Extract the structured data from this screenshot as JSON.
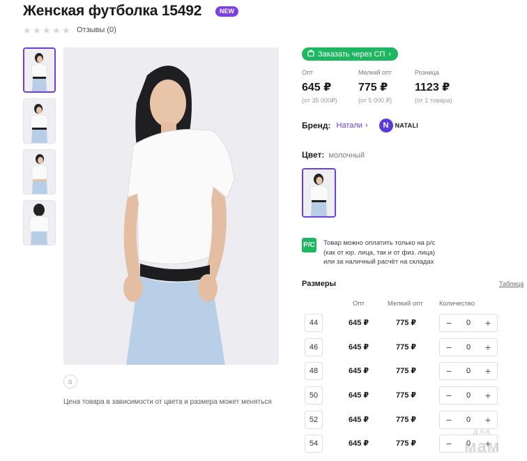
{
  "product": {
    "title": "Женская футболка 15492",
    "badge": "NEW",
    "rating_count_label": "Отзывы (0)",
    "rating_stars": 0
  },
  "gallery": {
    "thumbnails": [
      "photo-front",
      "photo-front-2",
      "photo-side",
      "photo-back"
    ],
    "note": "Цена товара в зависимости от цвета и размера может меняться"
  },
  "order": {
    "sp_button_label": "Заказать через СП"
  },
  "prices": [
    {
      "label": "Опт",
      "value": "645 ₽",
      "sub": "(от 35 000₽)"
    },
    {
      "label": "Мелкий опт",
      "value": "775 ₽",
      "sub": "(от 5 000 ₽)"
    },
    {
      "label": "Розница",
      "value": "1123 ₽",
      "sub": "(от 1 товара)"
    }
  ],
  "brand": {
    "label": "Бренд:",
    "name": "Натали",
    "logo_text": "NATALI"
  },
  "color": {
    "label": "Цвет:",
    "value": "молочный"
  },
  "payment": {
    "icon_text": "P/C",
    "text_line1": "Товар можно оплатить только на р/с",
    "text_line2": "(как от юр. лица, так и от физ. лица)",
    "text_line3": "или за наличный расчёт на складах"
  },
  "sizes": {
    "title": "Размеры",
    "table_link": "Таблица",
    "headers": {
      "opt": "Опт",
      "small_opt": "Мелкий опт",
      "qty": "Количество"
    },
    "rows": [
      {
        "size": "44",
        "opt": "645 ₽",
        "small_opt": "775 ₽",
        "qty": "0"
      },
      {
        "size": "46",
        "opt": "645 ₽",
        "small_opt": "775 ₽",
        "qty": "0"
      },
      {
        "size": "48",
        "opt": "645 ₽",
        "small_opt": "775 ₽",
        "qty": "0"
      },
      {
        "size": "50",
        "opt": "645 ₽",
        "small_opt": "775 ₽",
        "qty": "0"
      },
      {
        "size": "52",
        "opt": "645 ₽",
        "small_opt": "775 ₽",
        "qty": "0"
      },
      {
        "size": "54",
        "opt": "645 ₽",
        "small_opt": "775 ₽",
        "qty": "0"
      }
    ]
  },
  "watermark": {
    "line1": "для",
    "line2": "мам"
  },
  "colors": {
    "accent": "#6c3de0",
    "green": "#1cb760"
  }
}
